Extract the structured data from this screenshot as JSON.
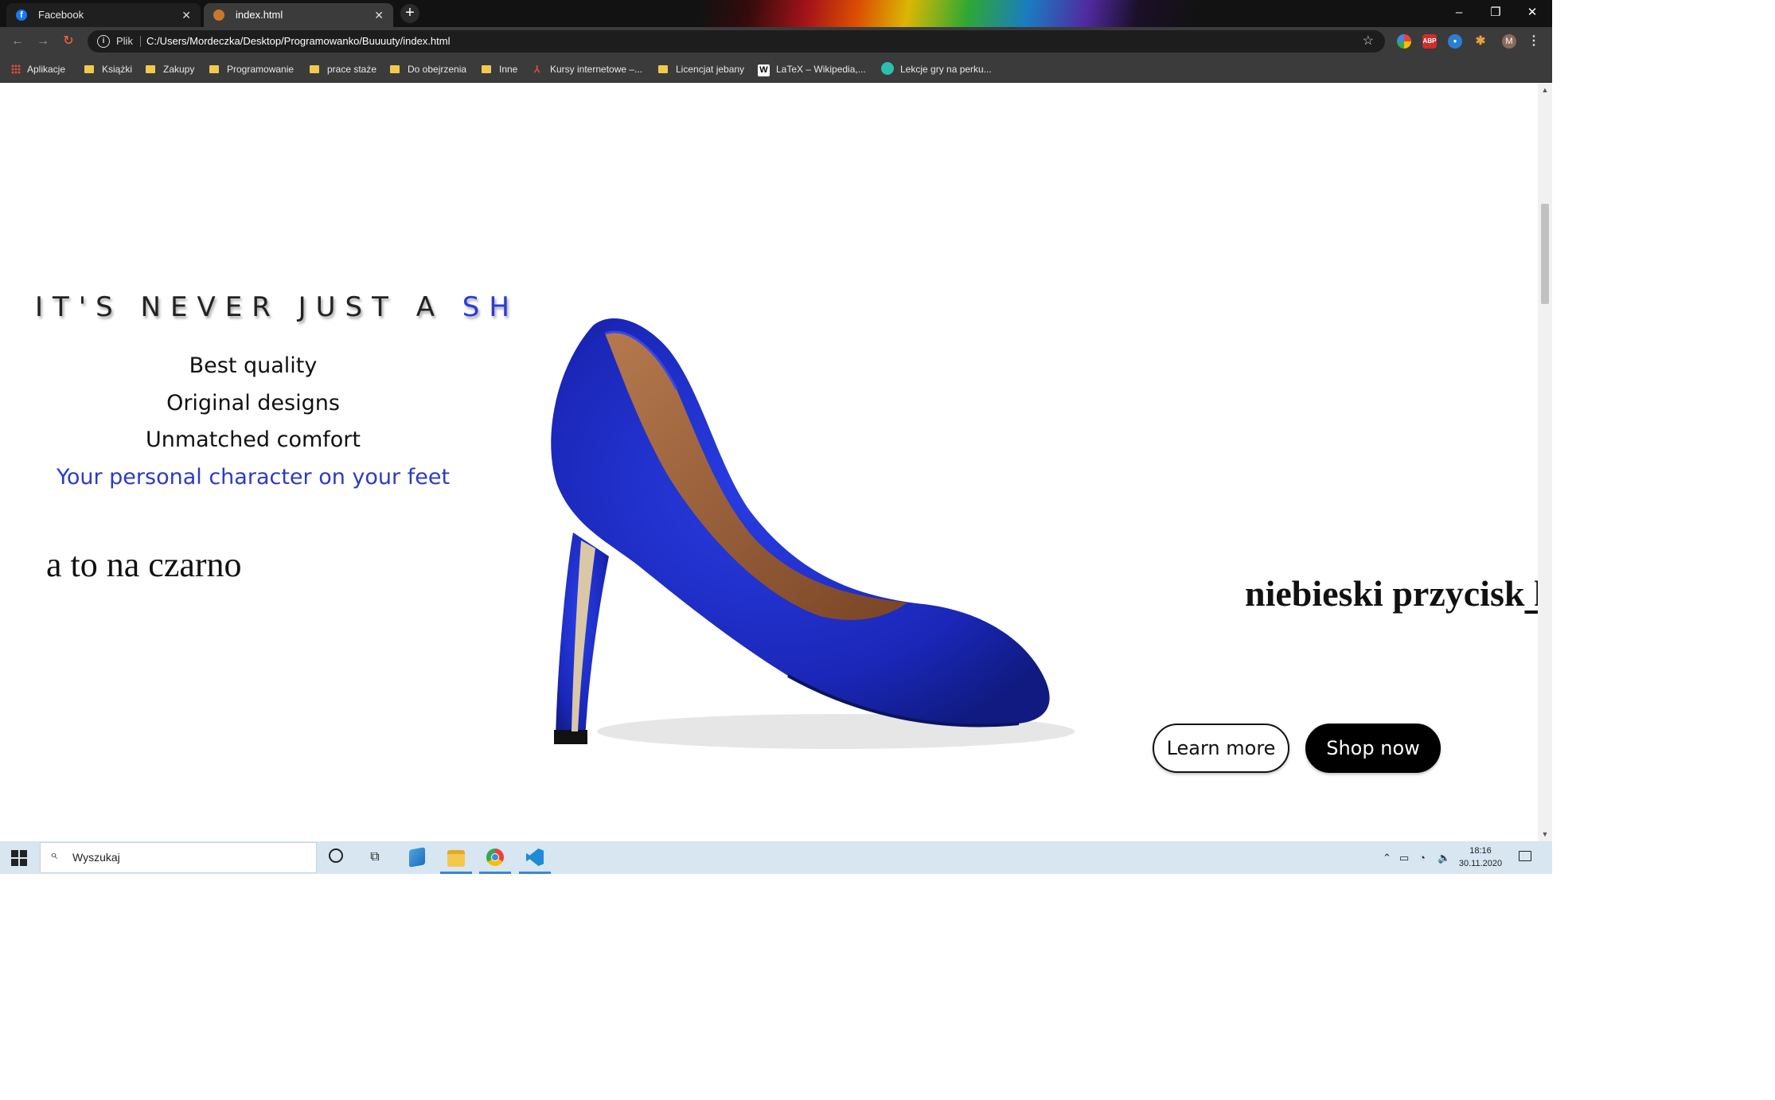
{
  "browser": {
    "tabs": [
      {
        "title": "Facebook",
        "favicon": "facebook-icon"
      },
      {
        "title": "index.html",
        "favicon": "web-page-icon",
        "active": true
      }
    ],
    "new_tab": "+",
    "window_controls": {
      "minimize": "–",
      "restore": "❐",
      "close": "✕"
    },
    "address_bar": {
      "scheme_label": "Plik",
      "url": "C:/Users/Mordeczka/Desktop/Programowanko/Buuuuty/index.html"
    },
    "profile_initial": "M",
    "extensions": [
      "google-icon",
      "adblock-plus-icon",
      "extension-icon",
      "puzzle-icon"
    ],
    "bookmarks": [
      {
        "label": "Aplikacje",
        "icon": "apps-grid-icon"
      },
      {
        "label": "Książki",
        "icon": "folder-icon"
      },
      {
        "label": "Zakupy",
        "icon": "folder-icon"
      },
      {
        "label": "Programowanie",
        "icon": "folder-icon"
      },
      {
        "label": "prace staże",
        "icon": "folder-icon"
      },
      {
        "label": "Do obejrzenia",
        "icon": "folder-icon"
      },
      {
        "label": "Inne",
        "icon": "folder-icon"
      },
      {
        "label": "Kursy internetowe –...",
        "icon": "kursy-icon"
      },
      {
        "label": "Licencjat jebany",
        "icon": "folder-icon"
      },
      {
        "label": "LaTeX – Wikipedia,...",
        "icon": "wikipedia-icon"
      },
      {
        "label": "Lekcje gry na perku...",
        "icon": "lessons-icon"
      }
    ]
  },
  "page": {
    "headline_main": "IT'S NEVER JUST A ",
    "headline_accent": "SH",
    "features": [
      "Best quality",
      "Original designs",
      "Unmatched comfort"
    ],
    "tagline": "Your personal character on your feet",
    "black_note": "a to na czarno",
    "blue_note": "niebieski przycisk",
    "blue_note_link": " kupić",
    "buttons": {
      "learn_more": "Learn more",
      "shop_now": "Shop now"
    },
    "colors": {
      "accent_blue": "#2c3ad6",
      "shoe_blue": "#1f2fd0",
      "button_black": "#000000"
    }
  },
  "taskbar": {
    "search_placeholder": "Wyszukaj",
    "pinned_apps": [
      "mail-app-icon",
      "file-explorer-icon",
      "chrome-icon",
      "vscode-icon"
    ],
    "time": "18:16",
    "date": "30.11.2020"
  }
}
